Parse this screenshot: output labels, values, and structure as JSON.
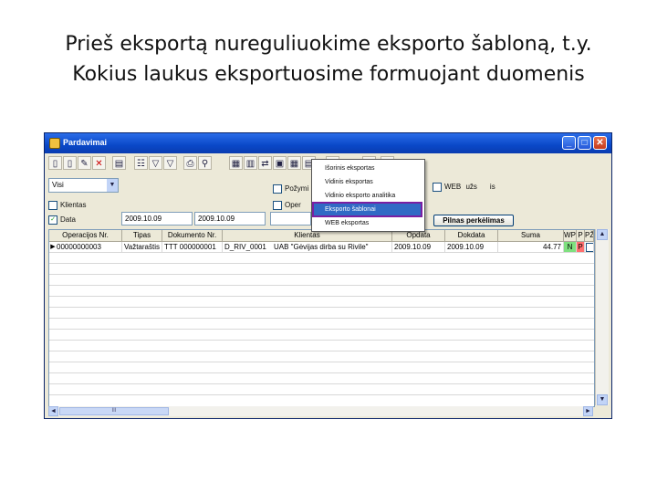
{
  "slide": {
    "title_line1": "Prieš eksportą nureguliuokime eksporto šabloną, t.y.",
    "title_line2": "Kokius laukus eksportuosime formuojant duomenis"
  },
  "window": {
    "title": "Pardavimai",
    "minimize_label": "_",
    "maximize_label": "□",
    "close_label": "✕",
    "colors": {
      "titlebar": "#0a48c8",
      "selection": "#316ac5",
      "highlight_border": "#7a1fa2",
      "wp_cell": "#7fe07f",
      "p_cell": "#ff6f6f"
    }
  },
  "toolbar": {
    "icons": [
      "new-doc-icon",
      "copy-doc-icon",
      "edit-doc-icon",
      "delete-icon",
      "page-icon",
      "tree-icon",
      "filter-icon",
      "filter-off-icon",
      "print-icon",
      "find-icon",
      "calc-icon",
      "export-icon",
      "grid-icon",
      "image-icon",
      "table-icon",
      "chart-icon",
      "export-menu-icon",
      "settings-icon",
      "help-icon"
    ],
    "glyphs": [
      "▯",
      "▯",
      "✎",
      "✕",
      "▤",
      "☷",
      "▽",
      "▽",
      "⎙",
      "⚲",
      "▦",
      "▥",
      "⇄",
      "▣",
      "▦",
      "▤",
      "▾",
      "▦",
      "?"
    ]
  },
  "filters": {
    "combo_value": "Visi",
    "combo_arrow": "▼",
    "klientas_label": "Klientas",
    "data_label": "Data",
    "data_checked": "✓",
    "date_from": "2009.10.09",
    "date_to": "2009.10.09",
    "pozymis_label": "Požymi",
    "oper_label": "Oper",
    "web_label": "WEB",
    "web_after": "užs",
    "web_tail": "is",
    "pilnas_button": "Pilnas perkėlimas"
  },
  "export_menu": {
    "items": [
      {
        "label": "Išorinis eksportas"
      },
      {
        "label": "Vidinis eksportas"
      },
      {
        "label": "Vidinio eksporto analitika"
      },
      {
        "label": "Eksporto šablonai"
      },
      {
        "label": "WEB eksportas"
      }
    ]
  },
  "grid": {
    "columns": [
      "Operacijos Nr.",
      "Tipas",
      "Dokumento Nr.",
      "Klientas",
      "Opdata",
      "Dokdata",
      "Suma",
      "WP",
      "P",
      "PŽ"
    ],
    "rows": [
      {
        "operacijos_nr": "00000000003",
        "tipas": "Važtaraštis",
        "dokumento_nr": "TTT 000000001",
        "klientas_id": "D_RIV_0001",
        "klientas": "UAB \"Gėvijas dirba su Rivile\"",
        "opdata": "2009.10.09",
        "dokdata": "2009.10.09",
        "suma": "44.77",
        "wp": "N",
        "p": "P",
        "pz": ""
      }
    ],
    "marker": "▶"
  },
  "scroll": {
    "up": "▲",
    "down": "▼",
    "left": "◄",
    "right": "►",
    "thumb": "III"
  }
}
